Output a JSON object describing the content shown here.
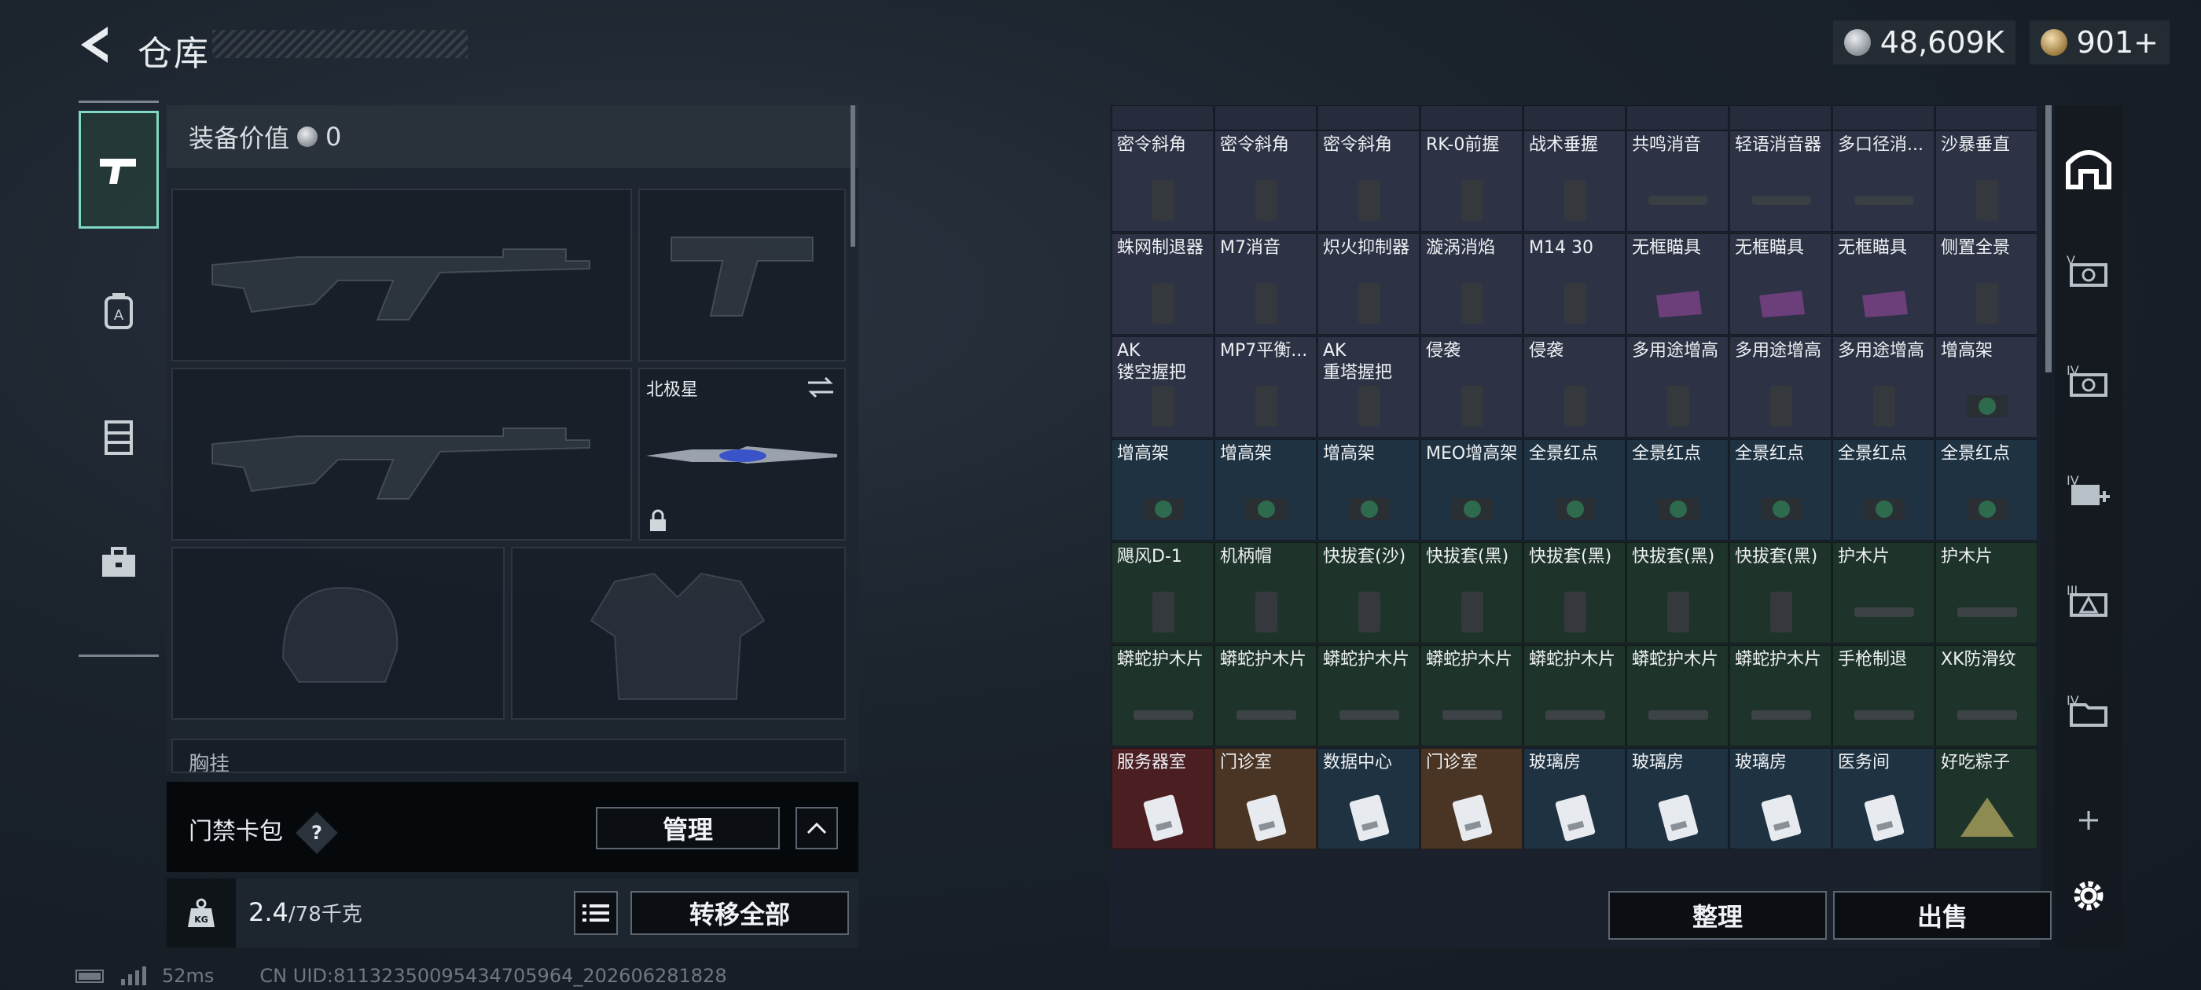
{
  "header": {
    "title": "仓库",
    "currency_value": "48,609K",
    "coupon_value": "901+"
  },
  "left_nav": [
    "pistol-icon",
    "backpack-icon",
    "vest-icon",
    "toolbox-icon"
  ],
  "equip": {
    "label": "装备价值",
    "value": "0",
    "slot_melee_label": "北极星",
    "partial_label": "胸挂",
    "card_pack_label": "门禁卡包",
    "help_label": "?",
    "manage_button": "管理",
    "weight_current": "2.4",
    "weight_max": "/78千克",
    "weight_badge": "KG",
    "transfer_all": "转移全部"
  },
  "status": {
    "ping": "52ms",
    "uid": "CN UID:8113235009543470596​4_202606281828"
  },
  "storage": {
    "rows": [
      {
        "bg": "bg-purple",
        "items": [
          "密令斜角",
          "密令斜角",
          "密令斜角",
          "RK-0前握",
          "战术垂握",
          "共鸣消音",
          "轻语消音器",
          "多口径消...",
          "沙暴垂直"
        ]
      },
      {
        "bg": "bg-purple",
        "items": [
          "蛛网制退器",
          "M7消音",
          "炽火抑制器",
          "漩涡消焰",
          "M14 30",
          "无框瞄具",
          "无框瞄具",
          "无框瞄具",
          "侧置全景"
        ]
      },
      {
        "bg": "bg-purple",
        "items": [
          "AK\n镂空握把",
          "MP7平衡...",
          "AK\n重塔握把",
          "侵袭",
          "侵袭",
          "多用途增高",
          "多用途增高",
          "多用途增高",
          "增高架"
        ]
      },
      {
        "bg": "bg-blue",
        "items": [
          "增高架",
          "增高架",
          "增高架",
          "MEO增高架",
          "全景红点",
          "全景红点",
          "全景红点",
          "全景红点",
          "全景红点"
        ]
      },
      {
        "bg": "bg-green",
        "items": [
          "飓风D-1",
          "机柄帽",
          "快拔套(沙)",
          "快拔套(黑)",
          "快拔套(黑)",
          "快拔套(黑)",
          "快拔套(黑)",
          "护木片",
          "护木片"
        ]
      },
      {
        "bg": "bg-green",
        "items": [
          "蟒蛇护木片",
          "蟒蛇护木片",
          "蟒蛇护木片",
          "蟒蛇护木片",
          "蟒蛇护木片",
          "蟒蛇护木片",
          "蟒蛇护木片",
          "手枪制退",
          "XK防滑纹"
        ]
      },
      {
        "bg": "bg-mixed",
        "items": [
          "服务器室",
          "门诊室",
          "数据中心",
          "门诊室",
          "玻璃房",
          "玻璃房",
          "玻璃房",
          "医务间",
          "好吃粽子"
        ]
      }
    ],
    "sort_button": "整理",
    "sell_button": "出售"
  },
  "right_nav": [
    "storage-home-icon",
    "tab-v-icon",
    "tab-iv-icon",
    "tab-iv-add-icon",
    "tab-iii-icon",
    "tab-iv-folder-icon",
    "add-tab-icon",
    "settings-icon"
  ]
}
